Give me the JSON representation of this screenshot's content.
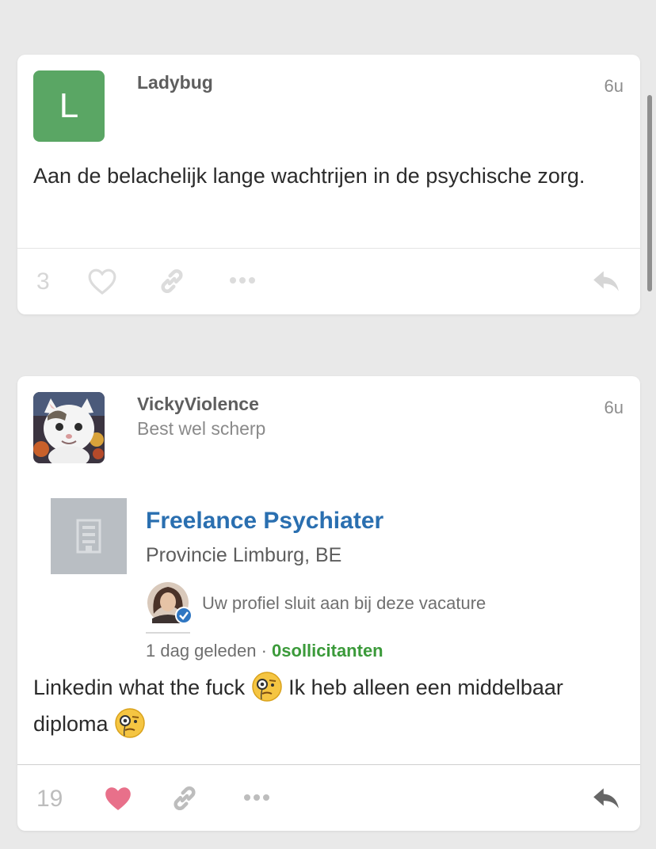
{
  "posts": [
    {
      "avatar_letter": "L",
      "avatar_color": "#5aa664",
      "username": "Ladybug",
      "time": "6u",
      "text": "Aan de belachelijk lange wachtrijen in de psychische zorg.",
      "like_count": "3",
      "liked": false
    },
    {
      "avatar_image": "white-cat-photo",
      "username": "VickyViolence",
      "subtitle": "Best wel scherp",
      "time": "6u",
      "embed": {
        "job_title": "Freelance Psychiater",
        "location": "Provincie Limburg, BE",
        "match_text": "Uw profiel sluit aan bij deze vacature",
        "posted": "1 dag geleden · ",
        "applicants": "0sollicitanten"
      },
      "text_part1": "Linkedin what the fuck ",
      "text_part2": " Ik heb alleen een middelbaar diploma ",
      "like_count": "19",
      "liked": true,
      "liked_color": "#e8708a"
    }
  ]
}
